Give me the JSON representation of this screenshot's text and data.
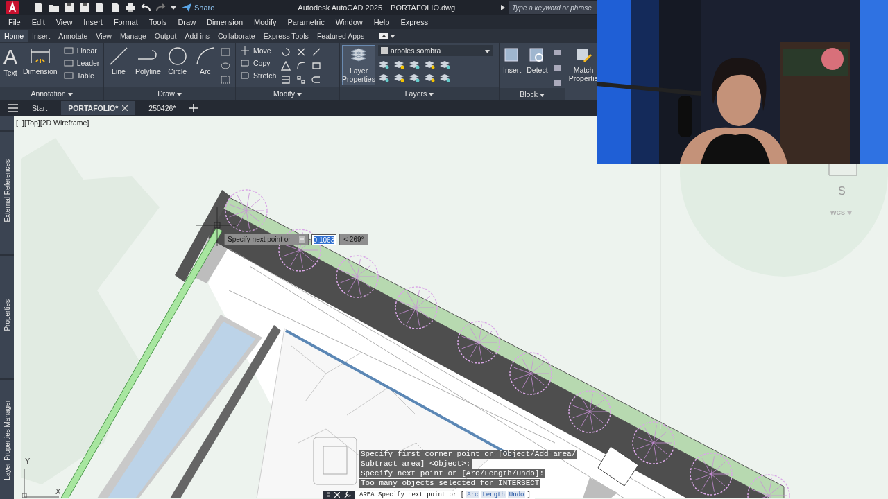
{
  "title_bar": {
    "share": "Share",
    "app_title": "Autodesk AutoCAD 2025",
    "file_name": "PORTAFOLIO.dwg",
    "search": {
      "placeholder": "Type a keyword or phrase"
    }
  },
  "menu_bar": [
    "File",
    "Edit",
    "View",
    "Insert",
    "Format",
    "Tools",
    "Draw",
    "Dimension",
    "Modify",
    "Parametric",
    "Window",
    "Help",
    "Express"
  ],
  "ribbon_tabs": [
    {
      "label": "Home",
      "selected": true
    },
    {
      "label": "Insert",
      "selected": false
    },
    {
      "label": "Annotate",
      "selected": false
    },
    {
      "label": "View",
      "selected": false
    },
    {
      "label": "Manage",
      "selected": false
    },
    {
      "label": "Output",
      "selected": false
    },
    {
      "label": "Add-ins",
      "selected": false
    },
    {
      "label": "Collaborate",
      "selected": false
    },
    {
      "label": "Express Tools",
      "selected": false
    },
    {
      "label": "Featured Apps",
      "selected": false
    }
  ],
  "ribbon_panels": [
    {
      "title": "Annotation",
      "text_icon": "A",
      "tools": [
        "Text",
        "Dimension",
        "Linear",
        "Leader",
        "Table"
      ]
    },
    {
      "title": "Draw",
      "tools": [
        "Line",
        "Polyline",
        "Circle",
        "Arc"
      ]
    },
    {
      "title": "Modify",
      "tools": [
        "Move",
        "Copy",
        "Stretch"
      ]
    },
    {
      "title": "Layers",
      "tools": [
        "Layer Properties"
      ],
      "current_layer": "arboles sombra"
    },
    {
      "title": "Block",
      "tools": [
        "Insert",
        "Detect"
      ]
    },
    {
      "tools": [
        "Match Propertie"
      ]
    }
  ],
  "file_tabs": [
    {
      "label": "Start",
      "selected": false
    },
    {
      "label": "PORTAFOLIO*",
      "selected": true
    },
    {
      "label": "250426*",
      "selected": false
    }
  ],
  "side_palettes": [
    "External References",
    "Properties",
    "Layer Properties Manager"
  ],
  "viewport_label": "[−][Top][2D Wireframe]",
  "dynamic_input": {
    "prompt": "Specify next point or",
    "value": "0.1063",
    "angle": "< 269°"
  },
  "command_history": [
    "Specify first corner point or [Object/Add area/",
    "Subtract area] <Object>:",
    "Specify next point or [Arc/Length/Undo]:",
    "Too many objects selected for INTERSECT"
  ],
  "command_line": {
    "prompt": "AREA Specify next point or [",
    "options": [
      "Arc",
      "Length",
      "Undo"
    ],
    "suffix": "]"
  },
  "viewcube": {
    "direction": "S",
    "ucs": "WCS"
  },
  "ucs_icon": {
    "y_label": "Y",
    "x_label": "X"
  },
  "webcam": {
    "kind": "picture"
  }
}
